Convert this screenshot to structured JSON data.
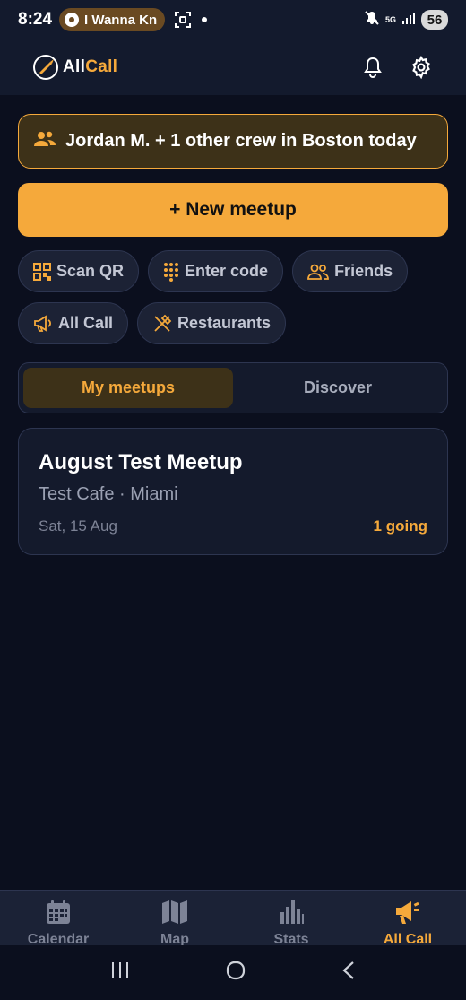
{
  "status_bar": {
    "time": "8:24",
    "media_title": "I Wanna Kn",
    "network": "5G",
    "battery": "56"
  },
  "header": {
    "logo_text_a": "All",
    "logo_text_b": "Call"
  },
  "crew_banner": {
    "text": "Jordan M. + 1 other crew in Boston today"
  },
  "new_meetup_label": "+ New meetup",
  "chips": {
    "scan_qr": "Scan QR",
    "enter_code": "Enter code",
    "friends": "Friends",
    "all_call": "All Call",
    "restaurants": "Restaurants"
  },
  "tabs": {
    "my_meetups": "My meetups",
    "discover": "Discover"
  },
  "meetup": {
    "title": "August Test Meetup",
    "subtitle": "Test Cafe · Miami",
    "date": "Sat, 15 Aug",
    "going": "1 going"
  },
  "bottom_nav": {
    "calendar": "Calendar",
    "map": "Map",
    "stats": "Stats",
    "all_call": "All Call"
  },
  "colors": {
    "accent": "#f5a93b",
    "background": "#0b0f1e",
    "surface": "#141a2c"
  }
}
